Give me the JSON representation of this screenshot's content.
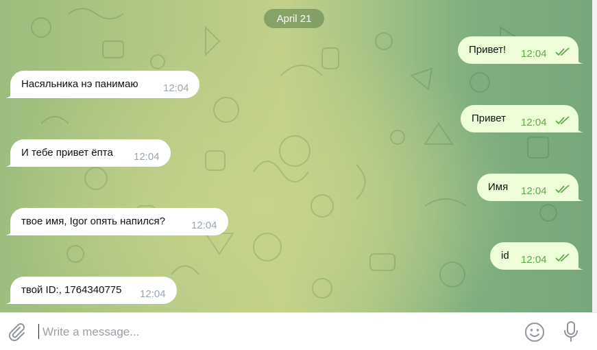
{
  "date_separator": "April 21",
  "messages": [
    {
      "direction": "out",
      "text": "Привет!",
      "time": "12:04",
      "status_icon": "double-check-read-icon"
    },
    {
      "direction": "in",
      "text": "Насяльника нэ панимаю",
      "time": "12:04"
    },
    {
      "direction": "out",
      "text": "Привет",
      "time": "12:04",
      "status_icon": "double-check-read-icon"
    },
    {
      "direction": "in",
      "text": "И тебе привет ёпта",
      "time": "12:04"
    },
    {
      "direction": "out",
      "text": "Имя",
      "time": "12:04",
      "status_icon": "double-check-read-icon"
    },
    {
      "direction": "in",
      "text": "твое имя, Igor опять напился?",
      "time": "12:04"
    },
    {
      "direction": "out",
      "text": "id",
      "time": "12:04",
      "status_icon": "double-check-read-icon"
    },
    {
      "direction": "in",
      "text": "твой ID:, 1764340775",
      "time": "12:04"
    }
  ],
  "composer": {
    "placeholder": "Write a message...",
    "value": "",
    "icons": [
      "paperclip-icon",
      "smiley-icon",
      "microphone-icon"
    ]
  },
  "colors": {
    "incoming_bubble": "#ffffff",
    "outgoing_bubble": "#eefed9",
    "outgoing_time_and_checks": "#5daa46",
    "incoming_time": "#9aa6b0",
    "date_pill": "#7e9f6a"
  }
}
